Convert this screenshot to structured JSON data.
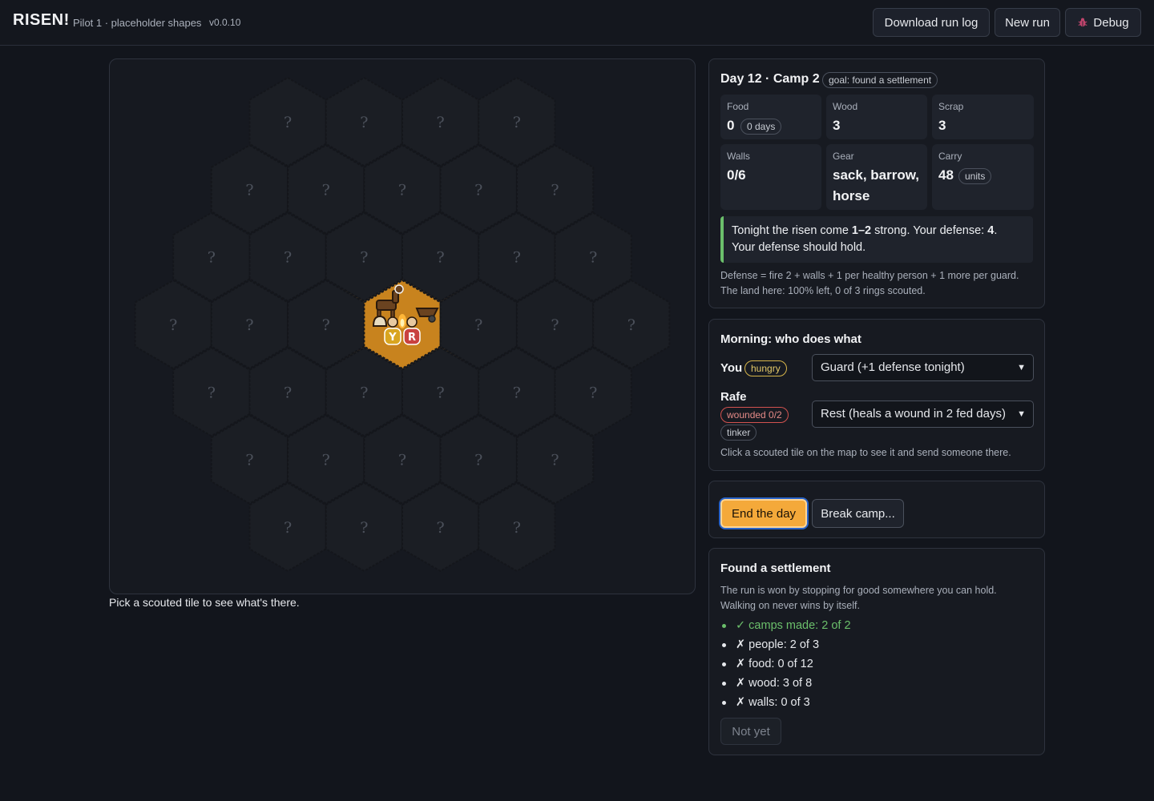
{
  "app": {
    "title": "RISEN!",
    "subtitle": "Pilot 1 · placeholder shapes",
    "version": "v0.0.10"
  },
  "toolbar": {
    "download_label": "Download run log",
    "new_run_label": "New run",
    "debug_label": "Debug"
  },
  "map": {
    "unknown_glyph": "?",
    "hint": "Pick a scouted tile to see what's there.",
    "camp_tile": {
      "row": 3,
      "col": 3
    },
    "tokens": [
      "Y",
      "R"
    ],
    "rows": [
      4,
      5,
      6,
      7,
      6,
      5,
      4
    ],
    "tile_color": "#1b1e24",
    "camp_color": "#c8831e"
  },
  "status": {
    "title": "Day 12 · Camp 2",
    "goal": "goal: found a settlement",
    "stats": {
      "food_label": "Food",
      "food_value": "0",
      "food_days": "0 days",
      "wood_label": "Wood",
      "wood_value": "3",
      "scrap_label": "Scrap",
      "scrap_value": "3",
      "walls_label": "Walls",
      "walls_value": "0/6",
      "gear_label": "Gear",
      "gear_line1": "sack, barrow,",
      "gear_line2": "horse",
      "carry_label": "Carry",
      "carry_value": "48",
      "carry_unit": "units"
    },
    "threat": {
      "pre": "Tonight the risen come ",
      "strength": "1–2",
      "mid": " strong. Your defense: ",
      "defense": "4",
      "post": ".",
      "line2": "Your defense should hold."
    },
    "formula": "Defense = fire 2 + walls + 1 per healthy person + 1 more per guard.",
    "land": "The land here: 100% left, 0 of 3 rings scouted."
  },
  "morning": {
    "title": "Morning: who does what",
    "you_name": "You",
    "you_tag": "hungry",
    "you_task": "Guard (+1 defense tonight)",
    "rafe_name": "Rafe",
    "rafe_tag1": "wounded 0/2",
    "rafe_tag2": "tinker",
    "rafe_task": "Rest (heals a wound in 2 fed days)",
    "hint": "Click a scouted tile on the map to see it and send someone there."
  },
  "actions": {
    "end_day": "End the day",
    "break_camp": "Break camp..."
  },
  "goal": {
    "title": "Found a settlement",
    "desc1": "The run is won by stopping for good somewhere you can hold.",
    "desc2": "Walking on never wins by itself.",
    "checks": [
      {
        "mark": "✓",
        "text": "camps made: 2 of 2",
        "done": true
      },
      {
        "mark": "✗",
        "text": "people: 2 of 3",
        "done": false
      },
      {
        "mark": "✗",
        "text": "food: 0 of 12",
        "done": false
      },
      {
        "mark": "✗",
        "text": "wood: 3 of 8",
        "done": false
      },
      {
        "mark": "✗",
        "text": "walls: 0 of 3",
        "done": false
      }
    ],
    "button": "Not yet"
  },
  "colors": {
    "accent": "#f4a93a",
    "ok": "#6bbf6b",
    "hungry": "#d6b54a",
    "wounded": "#d2524f"
  }
}
